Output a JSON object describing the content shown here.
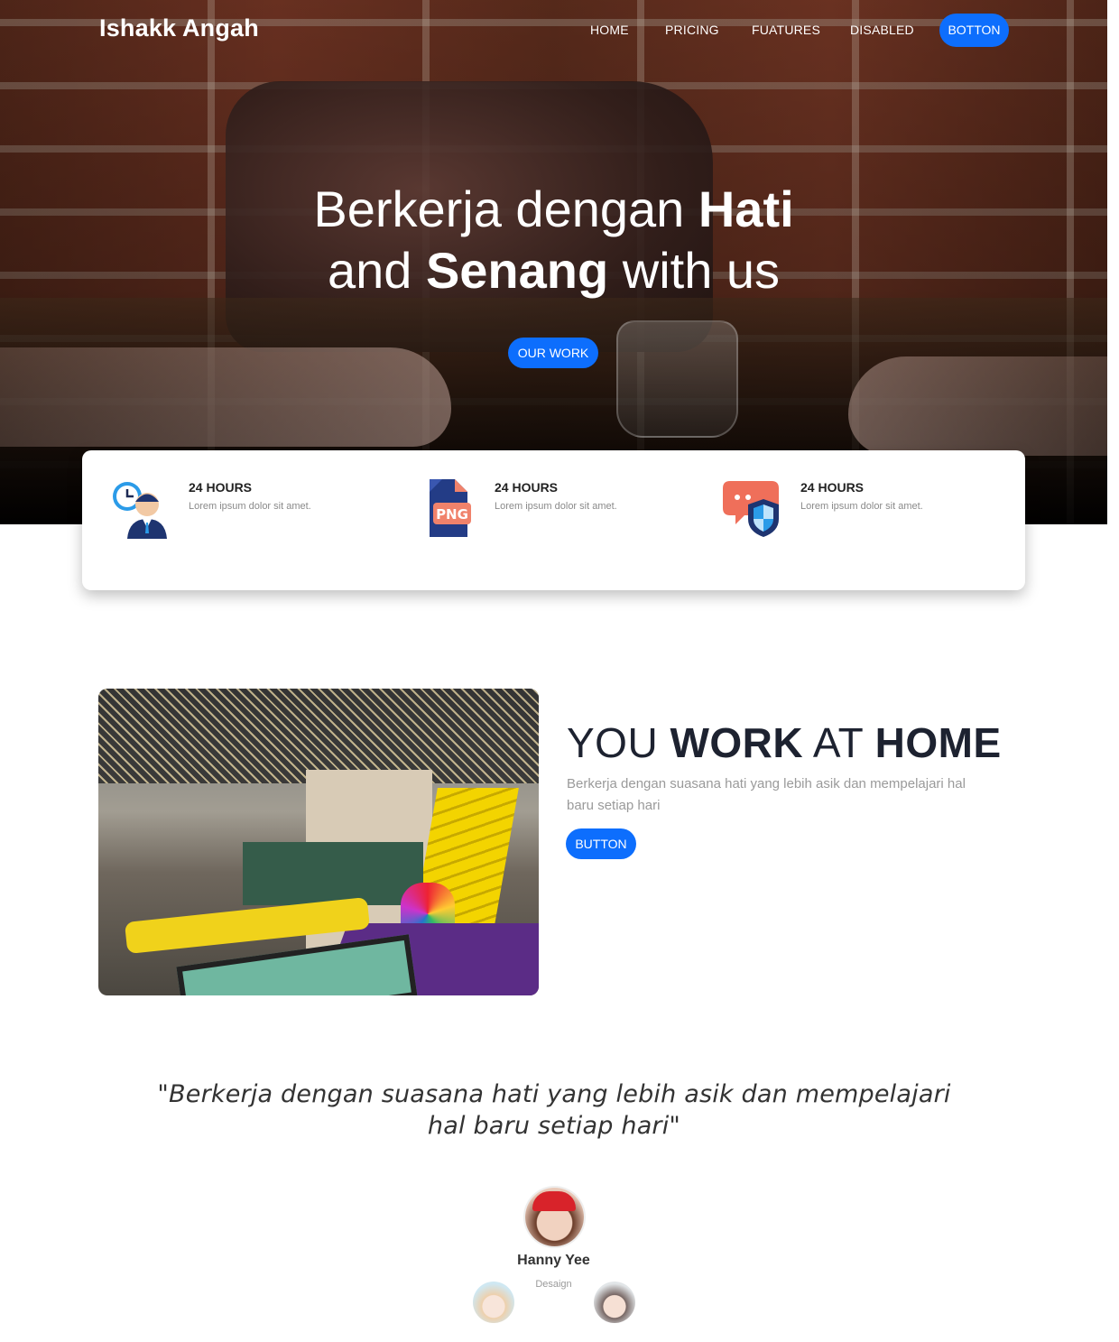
{
  "navbar": {
    "brand": "Ishakk Angah",
    "links": [
      "HOME",
      "PRICING",
      "FUATURES",
      "DISABLED"
    ],
    "cta": "BOTTON"
  },
  "hero": {
    "line1_light": "Berkerja dengan ",
    "line1_bold": "Hati",
    "line2_light_a": "and ",
    "line2_bold": "Senang",
    "line2_light_b": " with us",
    "button": "OUR WORK"
  },
  "info": [
    {
      "icon": "customer-support-icon",
      "title": "24 HOURS",
      "desc": "Lorem ipsum dolor sit amet."
    },
    {
      "icon": "png-file-icon",
      "title": "24 HOURS",
      "desc": "Lorem ipsum dolor sit amet."
    },
    {
      "icon": "secure-chat-shield-icon",
      "title": "24 HOURS",
      "desc": "Lorem ipsum dolor sit amet."
    }
  ],
  "work": {
    "title_light_a": "YOU ",
    "title_bold_a": "WORK",
    "title_light_b": " AT ",
    "title_bold_b": "HOME",
    "desc": "Berkerja dengan suasana hati yang lebih asik dan mempelajari hal baru setiap hari",
    "button": "BUTTON"
  },
  "testimonial": {
    "quote_line1": "\"Berkerja dengan suasana hati yang lebih asik dan mempelajari",
    "quote_line2": "hal baru setiap hari\"",
    "name": "Hanny Yee",
    "role": "Desaign"
  },
  "colors": {
    "accent": "#0d6efd",
    "heading": "#1d2230",
    "muted": "#9a9a9a"
  }
}
